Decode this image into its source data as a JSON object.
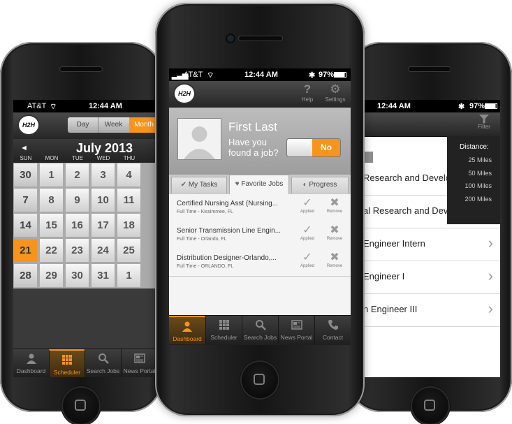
{
  "left_phone": {
    "status": {
      "carrier": "AT&T",
      "time": "12:44 AM"
    },
    "logo": "H2H",
    "view_tabs": [
      "Day",
      "Week",
      "Month"
    ],
    "view_active": "Month",
    "month_label": "July 2013",
    "prev_arrow": "◄",
    "weekdays": [
      "SUN",
      "MON",
      "TUE",
      "WED",
      "THU"
    ],
    "weeks": [
      [
        "30",
        "1",
        "2",
        "3",
        "4"
      ],
      [
        "7",
        "8",
        "9",
        "10",
        "11"
      ],
      [
        "14",
        "15",
        "16",
        "17",
        "18"
      ],
      [
        "21",
        "22",
        "23",
        "24",
        "25"
      ],
      [
        "28",
        "29",
        "30",
        "31",
        "1"
      ]
    ],
    "today": "21",
    "tabs": [
      {
        "label": "Dashboard",
        "icon": "person-icon"
      },
      {
        "label": "Scheduler",
        "icon": "calendar-grid-icon"
      },
      {
        "label": "Search Jobs",
        "icon": "search-icon"
      },
      {
        "label": "News Portal",
        "icon": "newspaper-icon"
      }
    ],
    "active_tab": "Scheduler"
  },
  "center_phone": {
    "status": {
      "carrier": "AT&T",
      "time": "12:44 AM",
      "battery": "97%"
    },
    "logo": "H2H",
    "header_buttons": [
      {
        "label": "Help",
        "icon": "question-icon"
      },
      {
        "label": "Settings",
        "icon": "gear-icon"
      }
    ],
    "profile": {
      "name": "First Last",
      "question_line1": "Have you",
      "question_line2": "found a job?",
      "toggle_value": "No"
    },
    "segments": [
      {
        "label": "My Tasks",
        "icon": "check-icon"
      },
      {
        "label": "Favorite Jobs",
        "icon": "heart-icon"
      },
      {
        "label": "Progress",
        "icon": "pie-icon"
      }
    ],
    "active_segment": "Favorite Jobs",
    "jobs": [
      {
        "title": "Certified Nursing Asst (Nursing...",
        "subtitle": "Full Time - Kissimmee, FL",
        "applied_label": "Applied",
        "remove_label": "Remove"
      },
      {
        "title": "Senior Transmission Line Engin...",
        "subtitle": "Full Time - Orlando, FL",
        "applied_label": "Applied",
        "remove_label": "Remove"
      },
      {
        "title": "Distribution Designer-Orlando,...",
        "subtitle": "Full Time - ORLANDO, FL",
        "applied_label": "Applied",
        "remove_label": "Remove"
      }
    ],
    "tabs": [
      {
        "label": "Dashboard",
        "icon": "person-icon"
      },
      {
        "label": "Scheduler",
        "icon": "calendar-grid-icon"
      },
      {
        "label": "Search Jobs",
        "icon": "search-icon"
      },
      {
        "label": "News Portal",
        "icon": "newspaper-icon"
      },
      {
        "label": "Contact",
        "icon": "phone-icon"
      }
    ],
    "active_tab": "Dashboard"
  },
  "right_phone": {
    "status": {
      "time": "12:44 AM",
      "battery": "97%"
    },
    "filter_label": "Filter",
    "distance": {
      "title": "Distance:",
      "options": [
        "25 Miles",
        "50 Miles",
        "100 Miles",
        "200 Miles"
      ]
    },
    "results": [
      "Research and Develop",
      "al Research and Deve",
      "Engineer Intern",
      "Engineer I",
      "n Engineer III"
    ]
  },
  "colors": {
    "accent": "#f7941d",
    "header_dark": "#2e2e2e",
    "screen_bg": "#e9e9e9"
  }
}
